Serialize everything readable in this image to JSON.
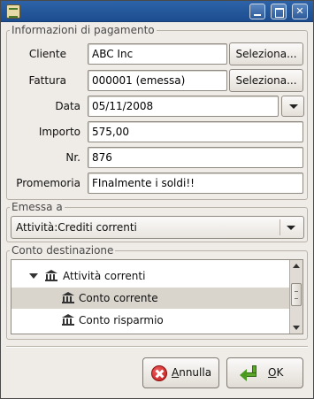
{
  "window": {
    "controls": {
      "minimize_icon": "minimize-icon",
      "maximize_icon": "maximize-icon",
      "close_icon": "close-icon",
      "close_glyph": "✕"
    }
  },
  "payment_info": {
    "group_label": "Informazioni di pagamento",
    "customer": {
      "label": "Cliente",
      "value": "ABC Inc",
      "select_button": "Seleziona..."
    },
    "invoice": {
      "label": "Fattura",
      "value": "000001 (emessa)",
      "select_button": "Seleziona..."
    },
    "date": {
      "label": "Data",
      "value": "05/11/2008"
    },
    "amount": {
      "label": "Importo",
      "value": "575,00"
    },
    "number": {
      "label": "Nr.",
      "value": "876"
    },
    "memo": {
      "label": "Promemoria",
      "value": "FInalmente i soldi!!"
    }
  },
  "posted_to": {
    "group_label": "Emessa a",
    "selected": "Attività:Crediti correnti"
  },
  "transfer_account": {
    "group_label": "Conto destinazione",
    "tree": [
      {
        "label": "Attività correnti",
        "expanded": true,
        "selected": false
      },
      {
        "label": "Conto corrente",
        "selected": true
      },
      {
        "label": "Conto risparmio",
        "selected": false
      }
    ]
  },
  "buttons": {
    "cancel": {
      "mnemonic": "A",
      "rest": "nnulla"
    },
    "ok": {
      "mnemonic": "O",
      "rest": "K"
    }
  },
  "colors": {
    "titlebar": "#1c4d8f",
    "window_bg": "#efebe7",
    "selection": "#d9d4cc",
    "cancel_red": "#c01818",
    "ok_green": "#5aa52a"
  }
}
